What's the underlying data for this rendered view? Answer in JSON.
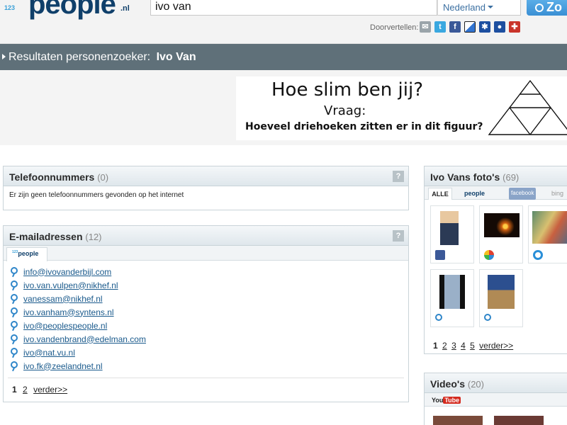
{
  "header": {
    "logo_123": "123",
    "logo_people": "people",
    "logo_nl": ".nl",
    "search_value": "ivo van",
    "country": "Nederland",
    "search_button": "Zo",
    "share_label": "Doorvertellen:"
  },
  "titlebar": {
    "prefix": "Resultaten personenzoeker:",
    "name": "Ivo Van"
  },
  "banner": {
    "line1": "Hoe slim ben jij?",
    "line2": "Vraag:",
    "line3": "Hoeveel driehoeken zitten er in dit figuur?"
  },
  "telefoon": {
    "title": "Telefoonnummers",
    "count": "(0)",
    "message": "Er zijn geen telefoonnummers gevonden op het internet",
    "help": "?"
  },
  "email": {
    "title": "E-mailadressen",
    "count": "(12)",
    "help": "?",
    "tab_label": "people",
    "tab_small": "123",
    "items": [
      "info@ivovanderbijl.com",
      "ivo.van.vulpen@nikhef.nl",
      "vanessam@nikhef.nl",
      "ivo.vanham@syntens.nl",
      "ivo@peoplespeople.nl",
      "ivo.vandenbrand@edelman.com",
      "ivo@nat.vu.nl",
      "ivo.fk@zeelandnet.nl"
    ],
    "pager": {
      "current": "1",
      "next_page": "2",
      "more": "verder>>"
    }
  },
  "photos": {
    "title": "Ivo Vans foto's",
    "count": "(69)",
    "tabs": {
      "all": "ALLE",
      "people": "people",
      "facebook": "facebook",
      "bing": "bing"
    },
    "pager": {
      "current": "1",
      "pages": [
        "2",
        "3",
        "4",
        "5"
      ],
      "more": "verder>>"
    }
  },
  "videos": {
    "title": "Video's",
    "count": "(20)",
    "source_you": "You",
    "source_tube": "Tube"
  },
  "colors": {
    "titlebar": "#5f7079",
    "link": "#1a5a8c",
    "accent": "#2f86c9"
  }
}
